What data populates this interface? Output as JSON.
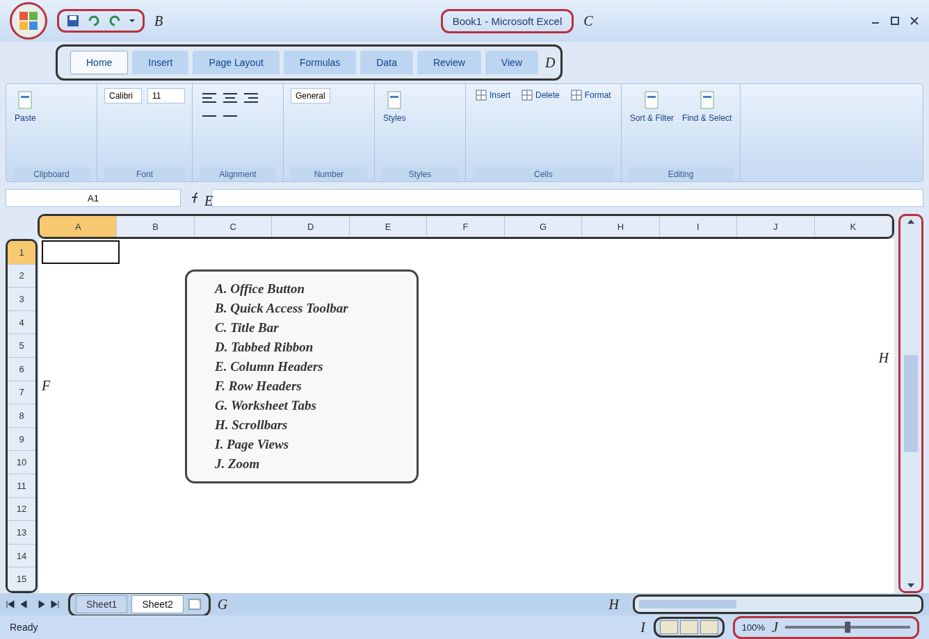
{
  "window": {
    "title": "Book1 - Microsoft Excel"
  },
  "callouts": {
    "quick_access": "B",
    "title": "C",
    "ribbon": "D",
    "column_headers": "E",
    "row_headers": "F",
    "sheet_tabs": "G",
    "scrollbar_vertical": "H",
    "scrollbar_horizontal": "H",
    "page_views": "I",
    "zoom": "J"
  },
  "tabs": [
    {
      "label": "Home",
      "selected": true
    },
    {
      "label": "Insert",
      "selected": false
    },
    {
      "label": "Page Layout",
      "selected": false
    },
    {
      "label": "Formulas",
      "selected": false
    },
    {
      "label": "Data",
      "selected": false
    },
    {
      "label": "Review",
      "selected": false
    },
    {
      "label": "View",
      "selected": false
    }
  ],
  "ribbon_groups": [
    {
      "name": "Clipboard",
      "items": [
        {
          "kind": "large",
          "label": "Paste"
        }
      ]
    },
    {
      "name": "Font",
      "items": [
        {
          "kind": "field",
          "label": "Calibri"
        },
        {
          "kind": "field",
          "label": "11"
        }
      ]
    },
    {
      "name": "Alignment",
      "items": [
        {
          "kind": "icons"
        }
      ]
    },
    {
      "name": "Number",
      "items": [
        {
          "kind": "field",
          "label": "General"
        }
      ]
    },
    {
      "name": "Styles",
      "items": [
        {
          "kind": "large",
          "label": "Styles"
        }
      ]
    },
    {
      "name": "Cells",
      "items": [
        {
          "kind": "small",
          "label": "Insert"
        },
        {
          "kind": "small",
          "label": "Delete"
        },
        {
          "kind": "small",
          "label": "Format"
        }
      ]
    },
    {
      "name": "Editing",
      "items": [
        {
          "kind": "large",
          "label": "Sort & Filter"
        },
        {
          "kind": "large",
          "label": "Find & Select"
        }
      ]
    }
  ],
  "name_box": "A1",
  "columns": [
    {
      "label": "A",
      "selected": true
    },
    {
      "label": "B",
      "selected": false
    },
    {
      "label": "C",
      "selected": false
    },
    {
      "label": "D",
      "selected": false
    },
    {
      "label": "E",
      "selected": false
    },
    {
      "label": "F",
      "selected": false
    },
    {
      "label": "G",
      "selected": false
    },
    {
      "label": "H",
      "selected": false
    },
    {
      "label": "I",
      "selected": false
    },
    {
      "label": "J",
      "selected": false
    },
    {
      "label": "K",
      "selected": false
    }
  ],
  "rows": [
    {
      "label": "1",
      "selected": true
    },
    {
      "label": "2",
      "selected": false
    },
    {
      "label": "3",
      "selected": false
    },
    {
      "label": "4",
      "selected": false
    },
    {
      "label": "5",
      "selected": false
    },
    {
      "label": "6",
      "selected": false
    },
    {
      "label": "7",
      "selected": false
    },
    {
      "label": "8",
      "selected": false
    },
    {
      "label": "9",
      "selected": false
    },
    {
      "label": "10",
      "selected": false
    },
    {
      "label": "11",
      "selected": false
    },
    {
      "label": "12",
      "selected": false
    },
    {
      "label": "13",
      "selected": false
    },
    {
      "label": "14",
      "selected": false
    },
    {
      "label": "15",
      "selected": false
    }
  ],
  "legend": [
    "A. Office Button",
    "B. Quick Access Toolbar",
    "C. Title Bar",
    "D. Tabbed Ribbon",
    "E. Column Headers",
    "F. Row Headers",
    "G. Worksheet Tabs",
    "H. Scrollbars",
    "I. Page Views",
    "J. Zoom"
  ],
  "sheets": [
    {
      "label": "Sheet1",
      "selected": false
    },
    {
      "label": "Sheet2",
      "selected": true
    }
  ],
  "status": "Ready",
  "zoom": "100%",
  "zoom_slider": {
    "level": 0.5
  }
}
